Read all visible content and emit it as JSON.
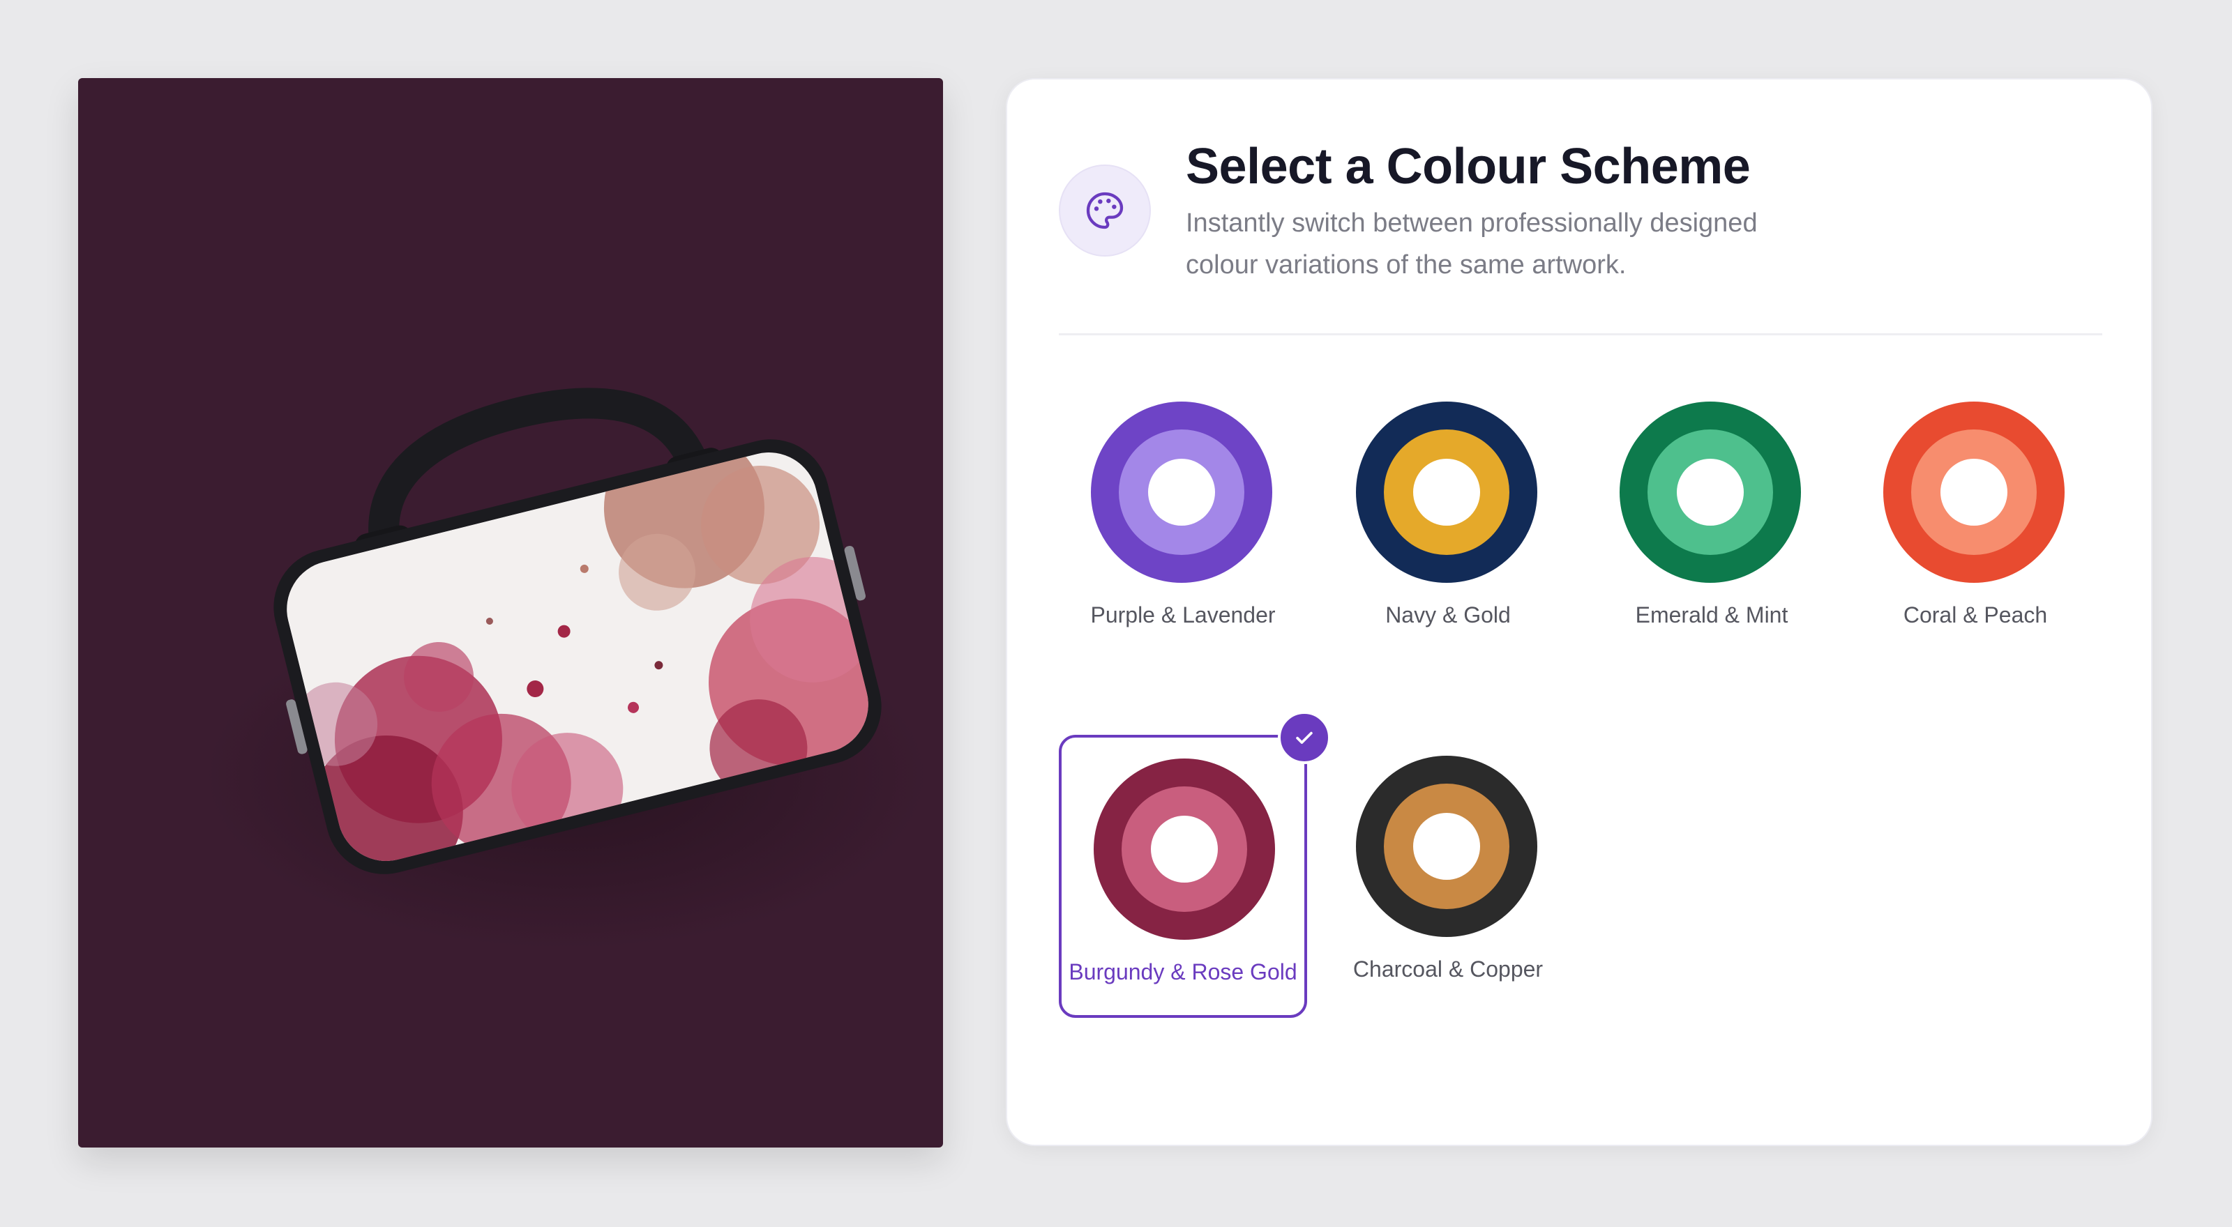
{
  "header": {
    "icon": "palette-icon",
    "title": "Select a Colour Scheme",
    "subtitle": "Instantly switch between professionally designed colour variations of the same artwork."
  },
  "preview": {
    "background": "#3b1c30",
    "product": "laptop bag"
  },
  "schemes": [
    {
      "label": "Purple & Lavender",
      "outer": "#6e44c6",
      "inner": "#a387e8",
      "selected": false
    },
    {
      "label": "Navy & Gold",
      "outer": "#122b57",
      "inner": "#e5a92a",
      "selected": false
    },
    {
      "label": "Emerald & Mint",
      "outer": "#0d7a4c",
      "inner": "#4ec08d",
      "selected": false
    },
    {
      "label": "Coral & Peach",
      "outer": "#e84b30",
      "inner": "#f78d6e",
      "selected": false
    },
    {
      "label": "Burgundy & Rose Gold",
      "outer": "#862344",
      "inner": "#c95e7e",
      "selected": true
    },
    {
      "label": "Charcoal & Copper",
      "outer": "#2b2b2b",
      "inner": "#c98944",
      "selected": false
    }
  ],
  "accent": "#6a3bbf"
}
